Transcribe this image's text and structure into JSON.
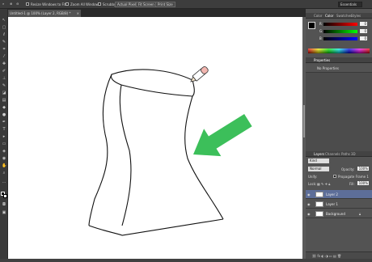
{
  "options_bar": {
    "resize_windows": "Resize Windows to Fit",
    "zoom_all": "Zoom All Windows",
    "scrubby": "Scrubby Zoom",
    "actual_pixels": "Actual Pixels",
    "fit_screen": "Fit Screen",
    "print_size": "Print Size",
    "workspace": "Essentials"
  },
  "document_tab": {
    "title": "Untitled-1 @ 100% (Layer 2, RGB/8) *"
  },
  "color_panel": {
    "tabs": [
      "Color",
      "Color",
      "Swatches",
      "Styles"
    ],
    "channels": [
      {
        "label": "R",
        "value": "0"
      },
      {
        "label": "G",
        "value": "0"
      },
      {
        "label": "B",
        "value": "0"
      }
    ]
  },
  "properties_panel": {
    "title": "Properties",
    "content": "No Properties"
  },
  "layers_panel": {
    "tabs": [
      "Layers",
      "Channels",
      "Paths",
      "3D"
    ],
    "kind": "Kind",
    "blend_mode": "Normal",
    "opacity_label": "Opacity:",
    "opacity_value": "100%",
    "unify_label": "Unify:",
    "propagate_label": "Propagate Frame 1",
    "lock_label": "Lock:",
    "fill_label": "Fill:",
    "fill_value": "100%",
    "layers": [
      {
        "name": "Layer 2",
        "selected": true
      },
      {
        "name": "Layer 1",
        "selected": false
      },
      {
        "name": "Background",
        "selected": false
      }
    ]
  },
  "colors": {
    "ui_dark": "#404040",
    "panel": "#535353",
    "selected_layer": "#5d6e99",
    "arrow_green": "#3cbf5a",
    "pencil_pink": "#f2b6b0"
  },
  "icons": {
    "zoom_tool": "magnifier-icon",
    "arrow": "green-arrow-icon",
    "pencil": "pencil-icon"
  }
}
